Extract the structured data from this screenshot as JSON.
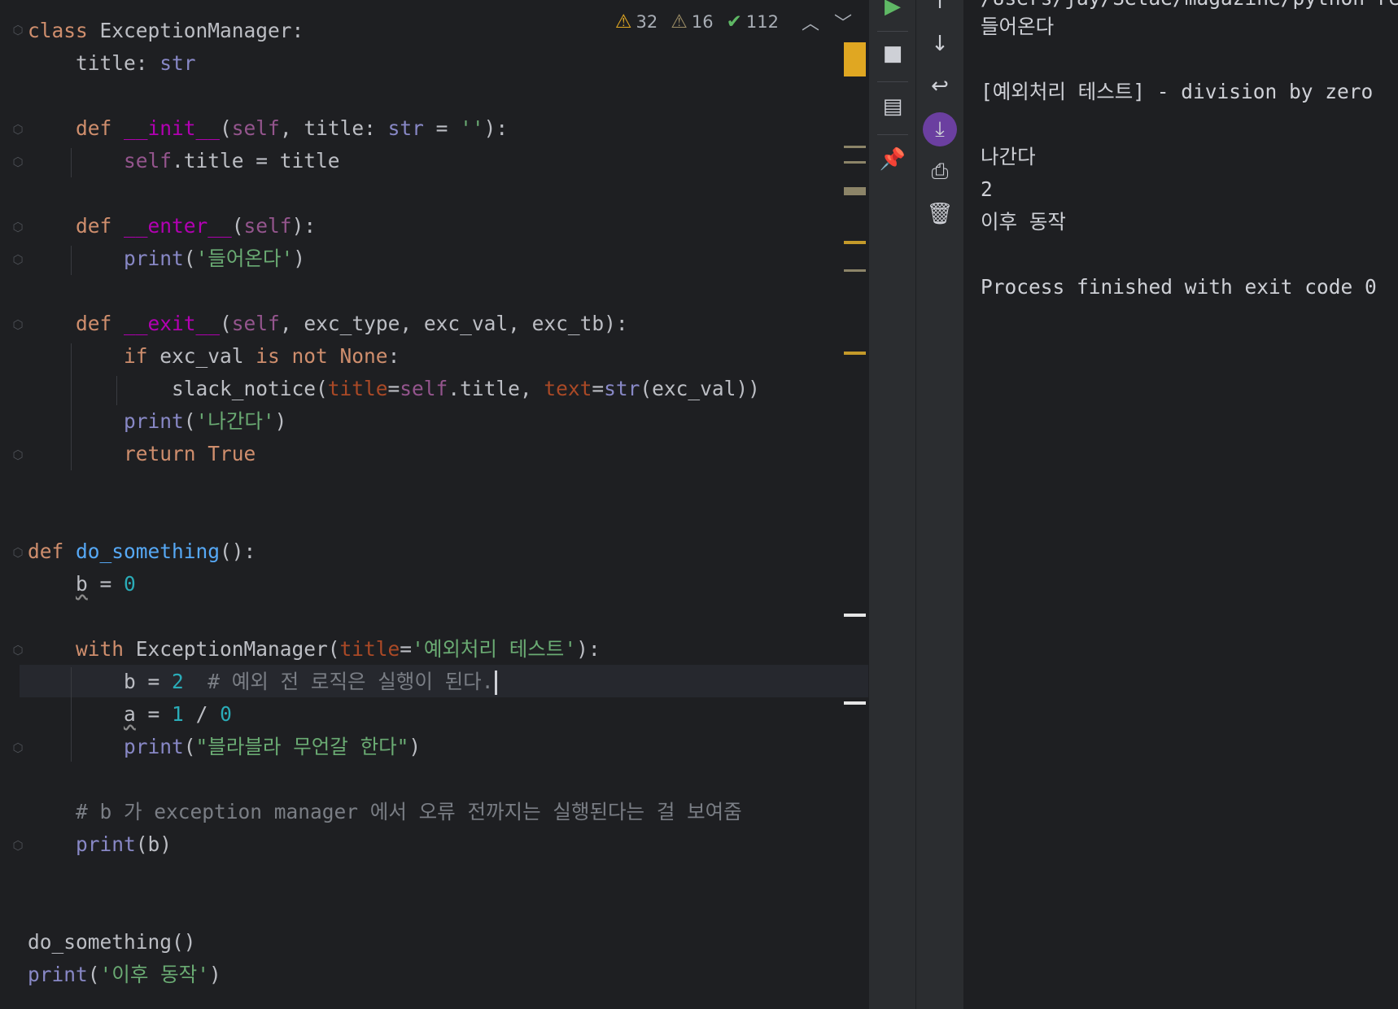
{
  "editor": {
    "lines": [
      [
        {
          "t": "class ",
          "c": "k"
        },
        {
          "t": "ExceptionManager:",
          "c": "fn"
        }
      ],
      [
        {
          "t": "    title: ",
          "c": "fn"
        },
        {
          "t": "str",
          "c": "b"
        }
      ],
      [],
      [
        {
          "t": "    def ",
          "c": "k"
        },
        {
          "t": "__init__",
          "c": "m"
        },
        {
          "t": "(",
          "c": "fn"
        },
        {
          "t": "self",
          "c": "sf"
        },
        {
          "t": ", title: ",
          "c": "fn"
        },
        {
          "t": "str",
          "c": "b"
        },
        {
          "t": " = ",
          "c": "fn"
        },
        {
          "t": "''",
          "c": "st"
        },
        {
          "t": "):",
          "c": "fn"
        }
      ],
      [
        {
          "t": "        ",
          "c": "fn"
        },
        {
          "t": "self",
          "c": "sf"
        },
        {
          "t": ".title = title",
          "c": "fn"
        }
      ],
      [],
      [
        {
          "t": "    def ",
          "c": "k"
        },
        {
          "t": "__enter__",
          "c": "m"
        },
        {
          "t": "(",
          "c": "fn"
        },
        {
          "t": "self",
          "c": "sf"
        },
        {
          "t": "):",
          "c": "fn"
        }
      ],
      [
        {
          "t": "        ",
          "c": "fn"
        },
        {
          "t": "print",
          "c": "b"
        },
        {
          "t": "(",
          "c": "fn"
        },
        {
          "t": "'들어온다'",
          "c": "st"
        },
        {
          "t": ")",
          "c": "fn"
        }
      ],
      [],
      [
        {
          "t": "    def ",
          "c": "k"
        },
        {
          "t": "__exit__",
          "c": "m"
        },
        {
          "t": "(",
          "c": "fn"
        },
        {
          "t": "self",
          "c": "sf"
        },
        {
          "t": ", exc_type, exc_val, exc_tb):",
          "c": "fn"
        }
      ],
      [
        {
          "t": "        ",
          "c": "fn"
        },
        {
          "t": "if ",
          "c": "k"
        },
        {
          "t": "exc_val ",
          "c": "fn"
        },
        {
          "t": "is not None",
          "c": "k"
        },
        {
          "t": ":",
          "c": "fn"
        }
      ],
      [
        {
          "t": "            slack_notice(",
          "c": "fn"
        },
        {
          "t": "title",
          "c": "p"
        },
        {
          "t": "=",
          "c": "fn"
        },
        {
          "t": "self",
          "c": "sf"
        },
        {
          "t": ".title, ",
          "c": "fn"
        },
        {
          "t": "text",
          "c": "p"
        },
        {
          "t": "=",
          "c": "fn"
        },
        {
          "t": "str",
          "c": "b"
        },
        {
          "t": "(exc_val))",
          "c": "fn"
        }
      ],
      [
        {
          "t": "        ",
          "c": "fn"
        },
        {
          "t": "print",
          "c": "b"
        },
        {
          "t": "(",
          "c": "fn"
        },
        {
          "t": "'나간다'",
          "c": "st"
        },
        {
          "t": ")",
          "c": "fn"
        }
      ],
      [
        {
          "t": "        ",
          "c": "fn"
        },
        {
          "t": "return True",
          "c": "k"
        }
      ],
      [],
      [],
      [
        {
          "t": "def ",
          "c": "k"
        },
        {
          "t": "do_something",
          "c": "f"
        },
        {
          "t": "():",
          "c": "fn"
        }
      ],
      [
        {
          "t": "    ",
          "c": "fn"
        },
        {
          "t": "b",
          "c": "fn ul"
        },
        {
          "t": " = ",
          "c": "fn"
        },
        {
          "t": "0",
          "c": "n"
        }
      ],
      [],
      [
        {
          "t": "    with ",
          "c": "k"
        },
        {
          "t": "ExceptionManager(",
          "c": "fn"
        },
        {
          "t": "title",
          "c": "p"
        },
        {
          "t": "=",
          "c": "fn"
        },
        {
          "t": "'예외처리 테스트'",
          "c": "st"
        },
        {
          "t": "):",
          "c": "fn"
        }
      ],
      [
        {
          "t": "        b = ",
          "c": "fn"
        },
        {
          "t": "2",
          "c": "n"
        },
        {
          "t": "  # 예외 전 로직은 실행이 된다.",
          "c": "c"
        }
      ],
      [
        {
          "t": "        ",
          "c": "fn"
        },
        {
          "t": "a",
          "c": "fn ul"
        },
        {
          "t": " = ",
          "c": "fn"
        },
        {
          "t": "1",
          "c": "n"
        },
        {
          "t": " / ",
          "c": "fn"
        },
        {
          "t": "0",
          "c": "n"
        }
      ],
      [
        {
          "t": "        ",
          "c": "fn"
        },
        {
          "t": "print",
          "c": "b"
        },
        {
          "t": "(",
          "c": "fn"
        },
        {
          "t": "\"블라블라 무언갈 한다\"",
          "c": "st"
        },
        {
          "t": ")",
          "c": "fn"
        }
      ],
      [],
      [
        {
          "t": "    # b 가 exception manager 에서 오류 전까지는 실행된다는 걸 보여줌",
          "c": "c"
        }
      ],
      [
        {
          "t": "    ",
          "c": "fn"
        },
        {
          "t": "print",
          "c": "b"
        },
        {
          "t": "(b)",
          "c": "fn"
        }
      ],
      [],
      [],
      [
        {
          "t": "do_something()",
          "c": "fn"
        }
      ],
      [
        {
          "t": "print",
          "c": "b"
        },
        {
          "t": "(",
          "c": "fn"
        },
        {
          "t": "'이후 동작'",
          "c": "st"
        },
        {
          "t": ")",
          "c": "fn"
        }
      ]
    ],
    "caret_line": 20
  },
  "inspections": {
    "warnings": "32",
    "weak_warnings": "16",
    "ok": "112"
  },
  "console": {
    "path_fragment": "/Users/jay/Setae/magazine/python-re",
    "lines": [
      "들어온다",
      "",
      "[예외처리 테스트] - division by zero",
      "",
      "나간다",
      "2",
      "이후 동작",
      "",
      "Process finished with exit code 0"
    ]
  },
  "colors": {
    "background": "#1e1f22",
    "keyword": "#cf8e6d",
    "string": "#6aab73",
    "number": "#2aacb8",
    "comment": "#7a7e85",
    "builtin": "#8888c6",
    "dunder": "#b200b2",
    "self": "#94558d",
    "param": "#aa4926",
    "accent_purple": "#6b3fa0"
  },
  "toolbar_icons": [
    "run-icon",
    "stop-icon",
    "layout-icon",
    "pin-icon",
    "up-arrow-icon",
    "down-arrow-icon",
    "soft-wrap-icon",
    "scroll-to-end-icon",
    "print-icon",
    "trash-icon"
  ]
}
